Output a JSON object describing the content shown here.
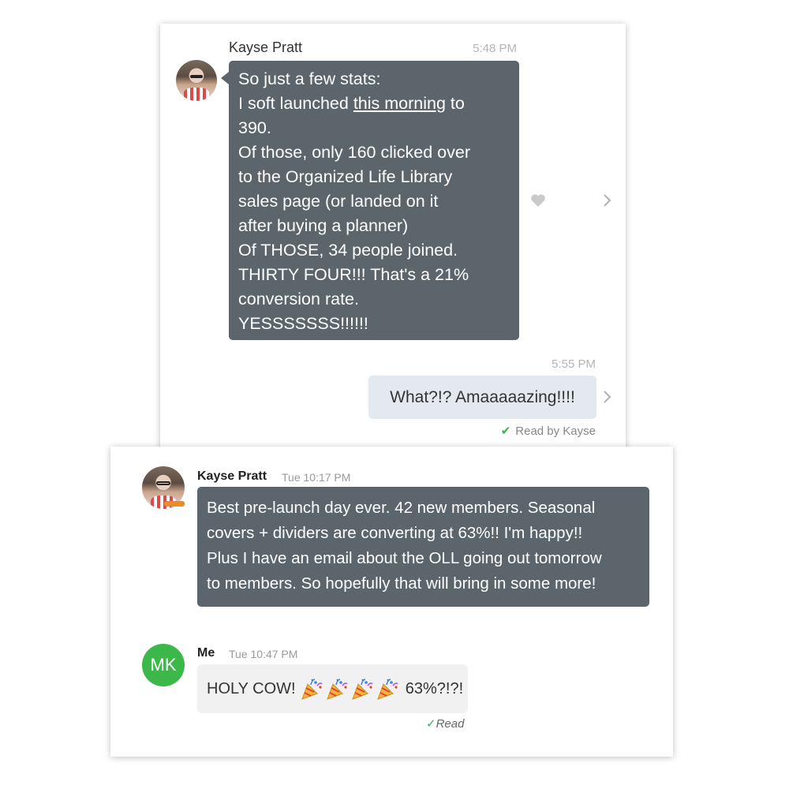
{
  "card1": {
    "sender": "Kayse Pratt",
    "time_received": "5:48 PM",
    "message_lines": [
      "So just a few stats:",
      "I soft launched ",
      "this morning",
      " to",
      "390.",
      "Of those, only 160 clicked over",
      "to the Organized Life Library",
      "sales page (or landed on it",
      "after buying a planner)",
      "Of THOSE, 34 people joined.",
      "THIRTY FOUR!!! That's a 21%",
      "conversion rate.",
      "YESSSSSSS!!!!!!"
    ],
    "time_sent": "5:55 PM",
    "reply": "What?!? Amaaaaazing!!!!",
    "read_receipt": "Read by Kayse",
    "icons": {
      "like": "heart-icon",
      "more": "chevron-right-icon",
      "check": "checkmark-icon"
    }
  },
  "card2": {
    "sender": "Kayse Pratt",
    "time_received": "Tue 10:17 PM",
    "message_lines": [
      "Best pre-launch day ever. 42 new members. Seasonal",
      "covers + dividers are converting at 63%!! I'm happy!!",
      "Plus I have an email about the OLL going out tomorrow",
      "to members. So hopefully that will bring in some more!"
    ],
    "me_initials": "MK",
    "me_label": "Me",
    "time_sent": "Tue 10:47 PM",
    "reply_start": "HOLY COW!",
    "reply_end": " 63%?!?!",
    "reply_emoji": "party-popper-icon",
    "reply_emoji_count": 4,
    "read_receipt": "Read"
  },
  "colors": {
    "bubble_dark": "#5c656c",
    "bubble_light": "#e3e9ef",
    "bubble_grey": "#f1f1f1",
    "avatar_green": "#3cb84a",
    "check_green": "#37b24d"
  }
}
